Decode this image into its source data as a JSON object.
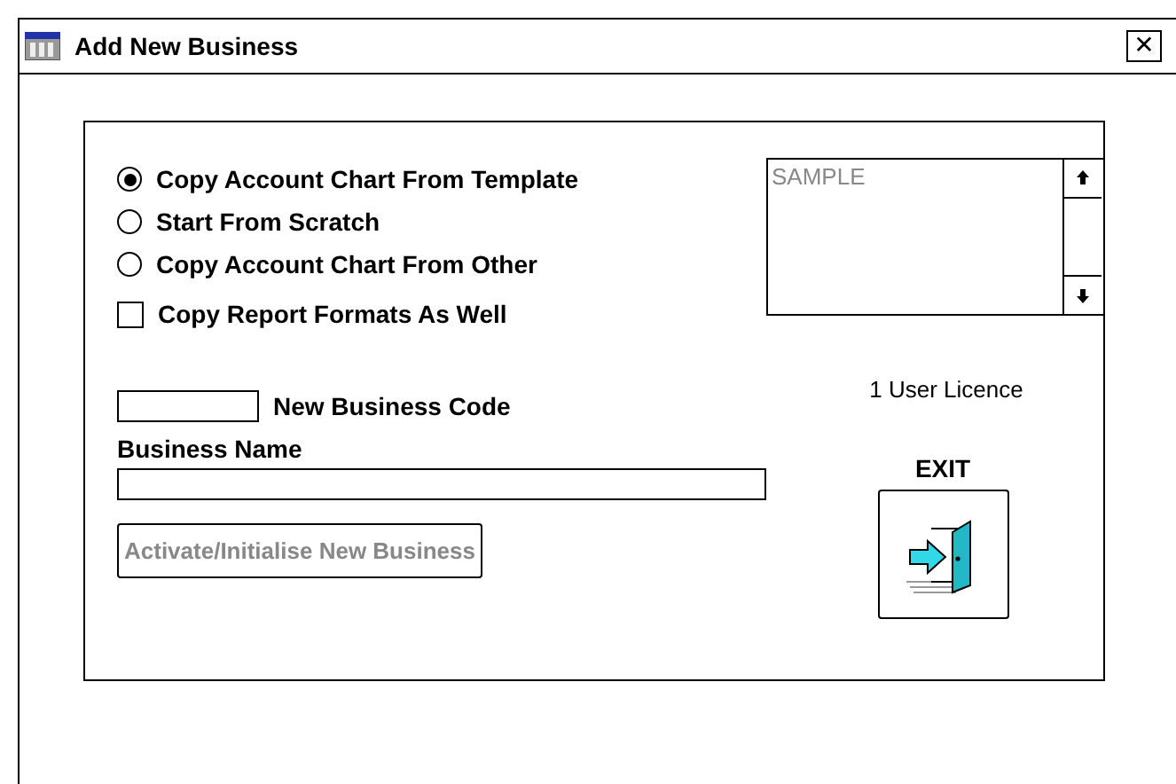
{
  "window": {
    "title": "Add New Business",
    "close": "✕"
  },
  "source_options": [
    {
      "label": "Copy Account Chart From Template",
      "selected": true
    },
    {
      "label": "Start From Scratch",
      "selected": false
    },
    {
      "label": "Copy Account Chart From Other",
      "selected": false
    }
  ],
  "copy_report_formats": {
    "label": "Copy Report Formats As Well",
    "checked": false
  },
  "template_list": {
    "items": [
      "SAMPLE"
    ]
  },
  "licence": "1  User Licence",
  "business_code": {
    "label": "New Business Code"
  },
  "business_name": {
    "label": "Business Name"
  },
  "activate_button": {
    "label": "Activate/Initialise New Business",
    "disabled": true
  },
  "exit": {
    "label": "EXIT"
  }
}
